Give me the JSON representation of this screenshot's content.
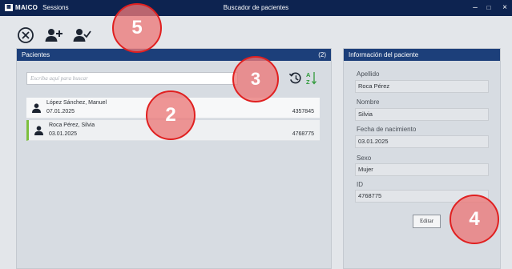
{
  "titlebar": {
    "brand": "MAICO",
    "app": "Sessions",
    "title": "Buscador de pacientes",
    "minimize_glyph": "–",
    "maximize_glyph": "□",
    "close_glyph": "×"
  },
  "toolbar": {
    "icons": [
      "close-circle-icon",
      "add-user-icon",
      "confirm-user-icon"
    ]
  },
  "patients_panel": {
    "title": "Pacientes",
    "count": "(2)",
    "search_placeholder": "Escriba aquí para buscar",
    "rows": [
      {
        "name": "López Sánchez, Manuel",
        "date": "07.01.2025",
        "id": "4357845",
        "selected": false
      },
      {
        "name": "Roca Pérez, Silvia",
        "date": "03.01.2025",
        "id": "4768775",
        "selected": true
      }
    ]
  },
  "info_panel": {
    "title": "Información del paciente",
    "fields": [
      {
        "label": "Apellido",
        "value": "Roca Pérez"
      },
      {
        "label": "Nombre",
        "value": "Silvia"
      },
      {
        "label": "Fecha de nacimiento",
        "value": "03.01.2025"
      },
      {
        "label": "Sexo",
        "value": "Mujer"
      },
      {
        "label": "ID",
        "value": "4768775"
      }
    ],
    "edit_label": "Editar"
  },
  "callouts": [
    "5",
    "3",
    "2",
    "4"
  ],
  "colors": {
    "titlebar": "#0d2350",
    "panel_header": "#1c3f7a",
    "selected_marker": "#7cbf3d",
    "callout_ring": "#e02020"
  }
}
